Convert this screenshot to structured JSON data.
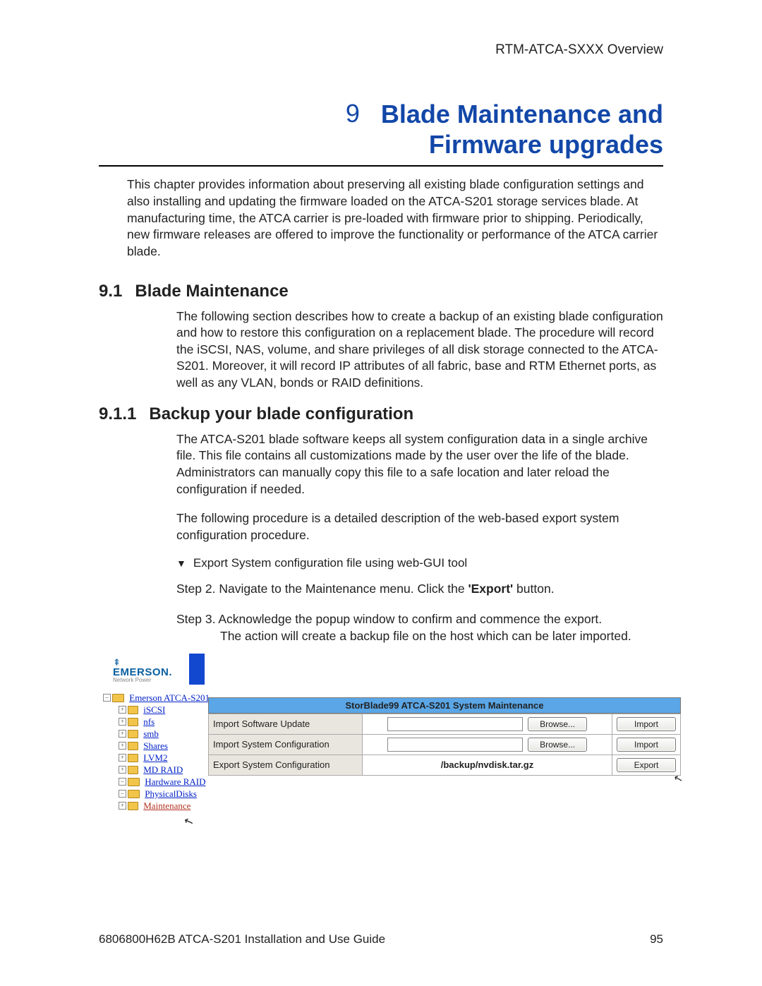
{
  "header": "RTM-ATCA-SXXX Overview",
  "chapter": {
    "num": "9",
    "title_l1": "Blade Maintenance and",
    "title_l2": "Firmware upgrades"
  },
  "intro": "This chapter provides information about preserving all existing blade configuration settings and also installing and updating the firmware loaded on the ATCA-S201 storage services blade.   At manufacturing time, the ATCA carrier is pre-loaded with firmware prior to shipping.  Periodically, new firmware releases are offered to improve the functionality or performance of the ATCA carrier blade.",
  "s91": {
    "num": "9.1",
    "title": "Blade Maintenance",
    "body": "The following section describes how to create a backup of an existing blade configuration and how to restore this configuration on a replacement blade.  The procedure will record the iSCSI, NAS, volume, and share privileges of all disk storage connected to the ATCA-S201.  Moreover, it will record IP attributes of all fabric, base and RTM Ethernet ports, as well as any VLAN, bonds or RAID definitions."
  },
  "s911": {
    "num": "9.1.1",
    "title": "Backup your blade configuration",
    "p1": "The ATCA-S201 blade software keeps all system configuration data in a single archive file.  This file contains all customizations made by the user over the life of the blade.  Administrators can manually copy this file to a safe location and later reload the configuration if needed.",
    "p2": "The following procedure is a detailed description of the web-based export system configuration procedure."
  },
  "proc": {
    "title": "Export System configuration file using web-GUI tool",
    "step2a": "Step 2.  Navigate to the Maintenance menu.  Click the ",
    "step2b": "'Export'",
    "step2c": " button.",
    "step3a": "Step 3.  Acknowledge the popup window to confirm and commence the export.",
    "step3b": "The action will create a backup file on the host which can be later imported."
  },
  "gui": {
    "logo": {
      "brand": "EMERSON.",
      "sub": "Network Power"
    },
    "tree": {
      "root": "Emerson ATCA-S201",
      "items": [
        "iSCSI",
        "nfs",
        "smb",
        "Shares",
        "LVM2",
        "MD RAID",
        "Hardware RAID",
        "PhysicalDisks",
        "Maintenance"
      ]
    },
    "panel_title": "StorBlade99 ATCA-S201 System Maintenance",
    "rows": [
      {
        "label": "Import Software Update",
        "value": "",
        "b1": "Browse...",
        "b2": "Import"
      },
      {
        "label": "Import System Configuration",
        "value": "",
        "b1": "Browse...",
        "b2": "Import"
      },
      {
        "label": "Export System Configuration",
        "value": "/backup/nvdisk.tar.gz",
        "b1": "",
        "b2": "Export"
      }
    ]
  },
  "footer": {
    "left": "6806800H62B ATCA-S201 Installation and Use Guide",
    "right": "95"
  }
}
